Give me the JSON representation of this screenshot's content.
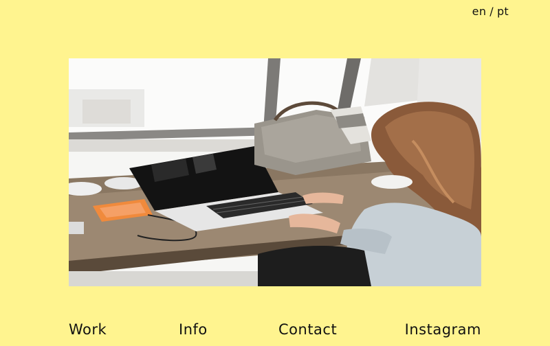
{
  "language_switch": {
    "en": "en",
    "separator": "/",
    "pt": "pt"
  },
  "hero_image": {
    "alt": "Woman typing on a laptop at a wooden desk by a window"
  },
  "nav": {
    "work": "Work",
    "info": "Info",
    "contact": "Contact",
    "instagram": "Instagram"
  },
  "colors": {
    "background": "#FFF48F",
    "text": "#111111"
  }
}
